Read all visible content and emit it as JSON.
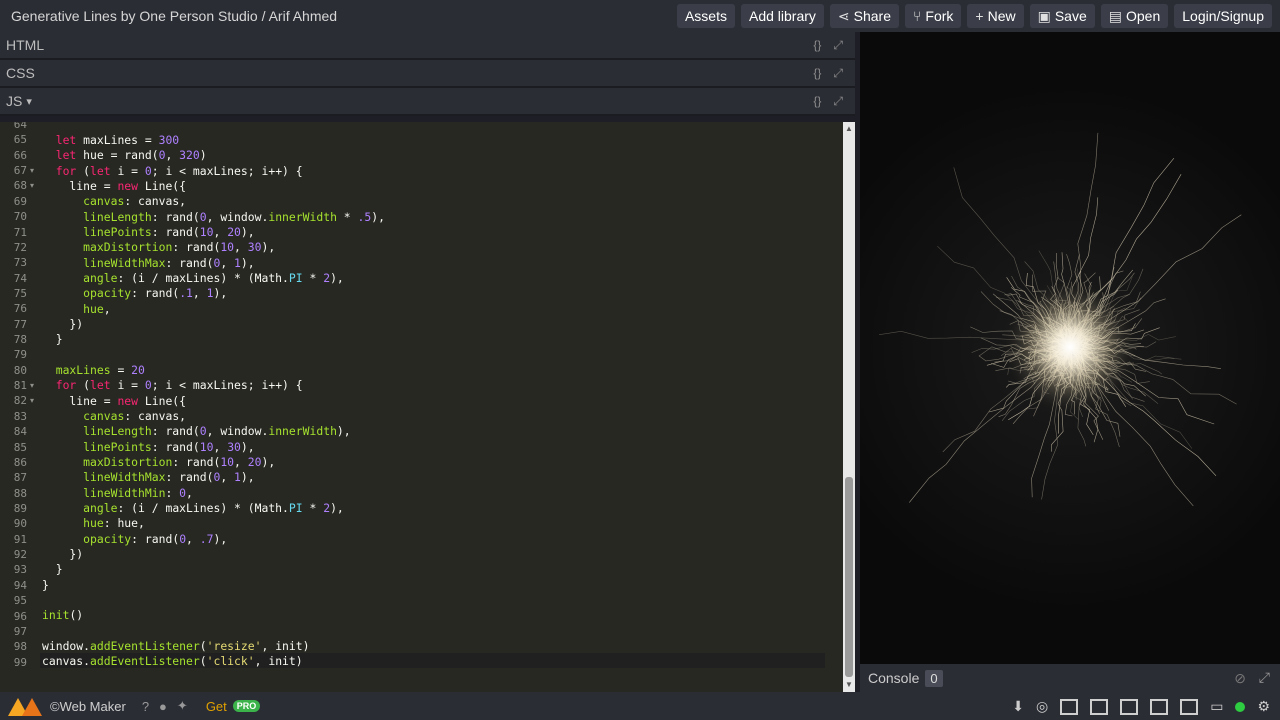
{
  "app": {
    "title": "Generative Lines by One Person Studio / Arif Ahmed"
  },
  "toolbar": {
    "assets": "Assets",
    "add_library": "Add library",
    "share": "Share",
    "fork": "Fork",
    "new": "New",
    "save": "Save",
    "open": "Open",
    "login": "Login/Signup"
  },
  "panes": {
    "html": "HTML",
    "css": "CSS",
    "js": "JS",
    "js_caret": "▾",
    "format_icon": "{}",
    "expand_icon": "⤢"
  },
  "code": {
    "line_numbers": [
      "64",
      "65",
      "66",
      "67",
      "68",
      "69",
      "70",
      "71",
      "72",
      "73",
      "74",
      "75",
      "76",
      "77",
      "78",
      "79",
      "80",
      "81",
      "82",
      "83",
      "84",
      "85",
      "86",
      "87",
      "88",
      "89",
      "90",
      "91",
      "92",
      "93",
      "94",
      "95",
      "96",
      "97",
      "98",
      "99"
    ],
    "fold_marker": "▾",
    "fold_lines": [
      "67",
      "68",
      "81",
      "82"
    ]
  },
  "console": {
    "label": "Console",
    "count": "0",
    "clear_icon": "⊘",
    "expand_icon": "⤢"
  },
  "footer": {
    "brand": "©Web Maker",
    "help_icon": "?",
    "chat_icon": "●",
    "twitter_icon": "✦",
    "get": "Get",
    "pro": "PRO",
    "download_icon": "⬇",
    "globe_icon": "◎",
    "monitor_icon": "▭",
    "settings_icon": "⚙"
  },
  "colors": {
    "keyword": "#f92672",
    "number": "#ae81ff",
    "string": "#e6db74",
    "property": "#a6e22e",
    "builtin": "#66d9ef",
    "accent": "#3bb34a"
  }
}
